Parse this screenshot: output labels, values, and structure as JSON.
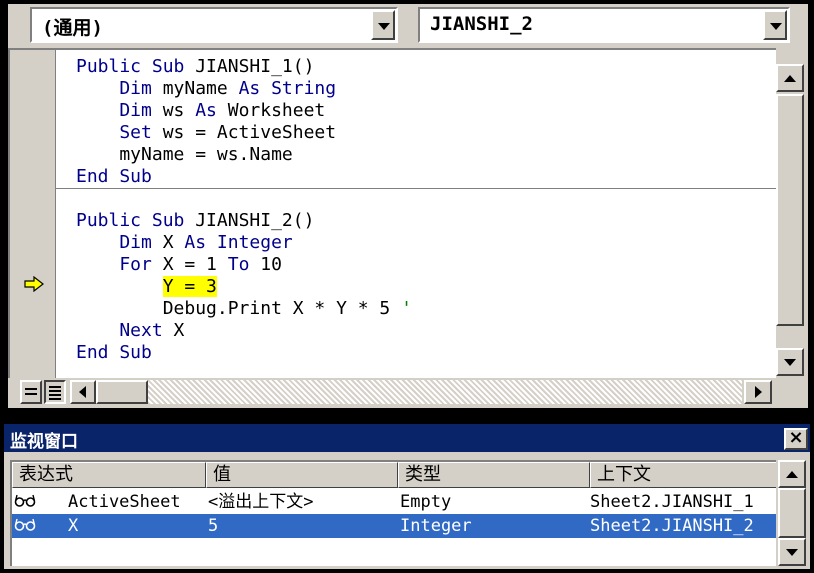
{
  "code_window": {
    "object_combo": "(通用)",
    "procedure_combo": "JIANSHI_2",
    "procedures": [
      {
        "lines": [
          [
            {
              "t": "Public Sub ",
              "kw": true
            },
            {
              "t": "JIANSHI_1()"
            }
          ],
          [
            {
              "t": "    Dim ",
              "kw": true
            },
            {
              "t": "myName "
            },
            {
              "t": "As String",
              "kw": true
            }
          ],
          [
            {
              "t": "    Dim ",
              "kw": true
            },
            {
              "t": "ws "
            },
            {
              "t": "As ",
              "kw": true
            },
            {
              "t": "Worksheet"
            }
          ],
          [
            {
              "t": "    Set ",
              "kw": true
            },
            {
              "t": "ws = ActiveSheet"
            }
          ],
          [
            {
              "t": "    myName = ws.Name"
            }
          ],
          [
            {
              "t": "End Sub",
              "kw": true
            }
          ]
        ]
      },
      {
        "lines": [
          [
            {
              "t": "Public Sub ",
              "kw": true
            },
            {
              "t": "JIANSHI_2()"
            }
          ],
          [
            {
              "t": "    Dim ",
              "kw": true
            },
            {
              "t": "X "
            },
            {
              "t": "As Integer",
              "kw": true
            }
          ],
          [
            {
              "t": "    For ",
              "kw": true
            },
            {
              "t": "X = 1 "
            },
            {
              "t": "To ",
              "kw": true
            },
            {
              "t": "10"
            }
          ],
          [
            {
              "t": "        "
            },
            {
              "t": "Y = 3",
              "hl": true
            }
          ],
          [
            {
              "t": "        Debug.Print X * Y * 5 "
            },
            {
              "t": "'",
              "green": true
            }
          ],
          [
            {
              "t": "    Next ",
              "kw": true
            },
            {
              "t": "X"
            }
          ],
          [
            {
              "t": "End Sub",
              "kw": true
            }
          ]
        ]
      }
    ],
    "current_line": "Y = 3"
  },
  "watch_window": {
    "title": "监视窗口",
    "close_label": "×",
    "columns": [
      "表达式",
      "值",
      "类型",
      "上下文"
    ],
    "rows": [
      {
        "expression": "ActiveSheet",
        "value": "<溢出上下文>",
        "type": "Empty",
        "context": "Sheet2.JIANSHI_1",
        "selected": false
      },
      {
        "expression": "X",
        "value": "5",
        "type": "Integer",
        "context": "Sheet2.JIANSHI_2",
        "selected": true
      }
    ]
  },
  "colors": {
    "keyword": "#00008b",
    "highlight": "#ffff00",
    "title_bar": "#0a246a",
    "selection": "#316ac5",
    "exec_arrow": "#ffff00"
  },
  "icons": {
    "exec_arrow": "execution-pointer-arrow-icon",
    "watch_glasses": "glasses-icon",
    "close": "close-icon"
  }
}
